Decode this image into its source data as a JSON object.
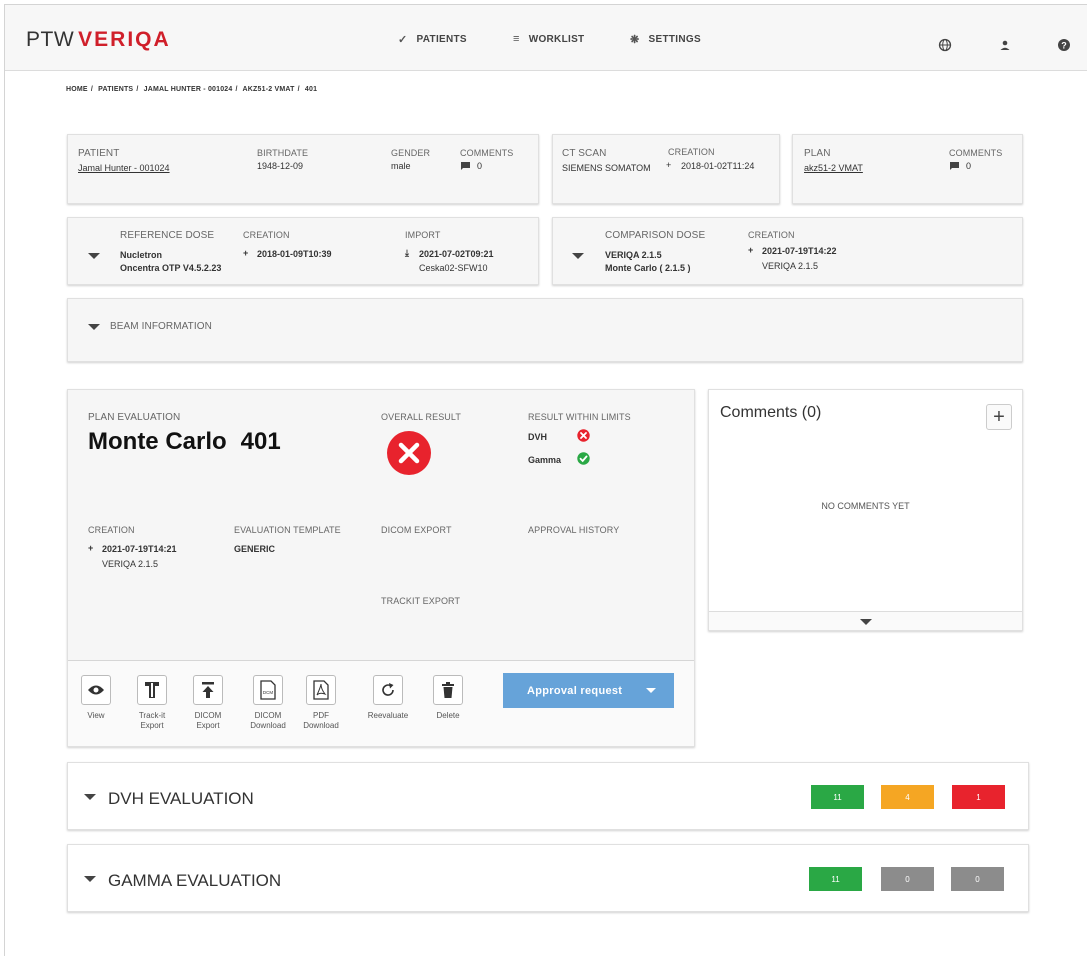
{
  "header": {
    "logo_prefix": "PTW",
    "logo_brand": "VERIQA",
    "nav": [
      {
        "label": "PATIENTS",
        "icon": "check-icon"
      },
      {
        "label": "WORKLIST",
        "icon": "list-icon"
      },
      {
        "label": "SETTINGS",
        "icon": "gear-icon"
      }
    ],
    "icons": [
      "globe-icon",
      "user-icon",
      "help-icon"
    ]
  },
  "breadcrumb": [
    "HOME",
    "PATIENTS",
    "JAMAL HUNTER - 001024",
    "AKZ51-2 VMAT",
    "401"
  ],
  "patient_card": {
    "patient_label": "PATIENT",
    "patient_value": "Jamal Hunter - 001024",
    "birthdate_label": "BIRTHDATE",
    "birthdate_value": "1948-12-09",
    "gender_label": "GENDER",
    "gender_value": "male",
    "comments_label": "COMMENTS",
    "comments_value": "0"
  },
  "ct_card": {
    "ct_label": "CT SCAN",
    "ct_value": "SIEMENS SOMATOM",
    "creation_label": "CREATION",
    "creation_value": "2018-01-02T11:24"
  },
  "plan_card": {
    "plan_label": "PLAN",
    "plan_value": "akz51-2 VMAT",
    "comments_label": "COMMENTS",
    "comments_value": "0"
  },
  "reference_dose": {
    "label": "REFERENCE DOSE",
    "line1": "Nucletron",
    "line2": "Oncentra OTP V4.5.2.23",
    "creation_label": "CREATION",
    "creation_value": "2018-01-09T10:39",
    "import_label": "IMPORT",
    "import_value": "2021-07-02T09:21",
    "import_source": "Ceska02-SFW10"
  },
  "comparison_dose": {
    "label": "COMPARISON DOSE",
    "line1": "VERIQA 2.1.5",
    "line2": "Monte Carlo ( 2.1.5 )",
    "creation_label": "CREATION",
    "creation_value": "2021-07-19T14:22",
    "creation_source": "VERIQA 2.1.5"
  },
  "beam_info": {
    "label": "BEAM INFORMATION"
  },
  "plan_evaluation": {
    "label": "PLAN EVALUATION",
    "title": "Monte Carlo",
    "number": "401",
    "overall_label": "OVERALL RESULT",
    "limits_label": "RESULT WITHIN LIMITS",
    "limits": [
      {
        "name": "DVH",
        "status": "fail"
      },
      {
        "name": "Gamma",
        "status": "pass"
      }
    ],
    "creation_label": "CREATION",
    "creation_value": "2021-07-19T14:21",
    "creation_source": "VERIQA 2.1.5",
    "template_label": "EVALUATION TEMPLATE",
    "template_value": "GENERIC",
    "dicom_export_label": "DICOM EXPORT",
    "approval_history_label": "APPROVAL HISTORY",
    "trackit_export_label": "TRACKIT EXPORT"
  },
  "toolbar": {
    "tools": [
      {
        "l1": "View",
        "l2": ""
      },
      {
        "l1": "Track-it",
        "l2": "Export"
      },
      {
        "l1": "DICOM",
        "l2": "Export"
      },
      {
        "l1": "DICOM",
        "l2": "Download"
      },
      {
        "l1": "PDF",
        "l2": "Download"
      },
      {
        "l1": "Reevaluate",
        "l2": ""
      },
      {
        "l1": "Delete",
        "l2": ""
      }
    ],
    "approval_label": "Approval request"
  },
  "comments_panel": {
    "title": "Comments (0)",
    "empty_text": "NO COMMENTS YET"
  },
  "dvh_evaluation": {
    "label": "DVH EVALUATION",
    "badges": [
      "11",
      "4",
      "1"
    ]
  },
  "gamma_evaluation": {
    "label": "GAMMA EVALUATION",
    "badges": [
      "11",
      "0",
      "0"
    ]
  },
  "colors": {
    "brand": "#d01f2a",
    "accent": "#66a3d9",
    "pass": "#2aa845",
    "warn": "#f5a623",
    "fail": "#e8232d",
    "neutral": "#8c8c8c"
  }
}
